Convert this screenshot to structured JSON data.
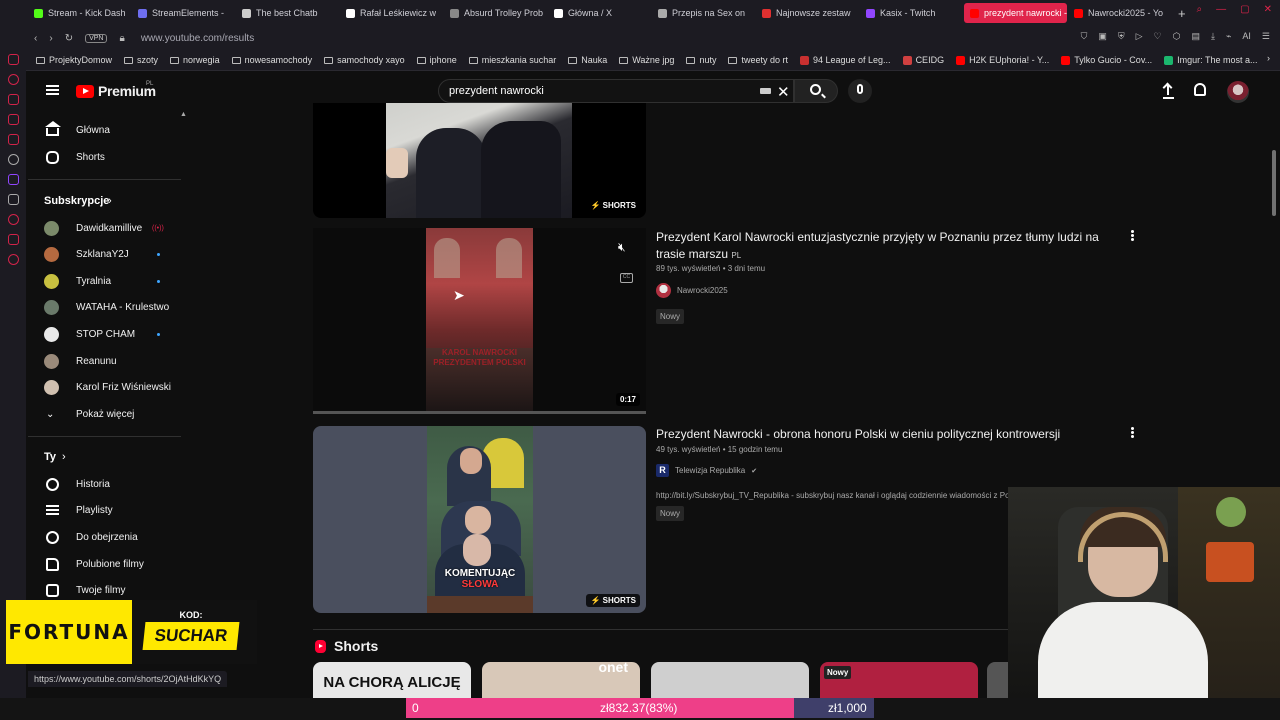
{
  "browser": {
    "tabs": [
      {
        "label": "Stream - Kick Dash",
        "color": "#53fc18"
      },
      {
        "label": "StreamElements - ",
        "color": "#6e6ef0"
      },
      {
        "label": "The best Chatb",
        "color": "#cccccc"
      },
      {
        "label": "Rafał Leśkiewicz w",
        "color": "#ffffff"
      },
      {
        "label": "Absurd Trolley Prob",
        "color": "#888888"
      },
      {
        "label": "Główna / X",
        "color": "#ffffff"
      },
      {
        "label": "Przepis na Sex on",
        "color": "#aaaaaa"
      },
      {
        "label": "Najnowsze zestaw",
        "color": "#e03030"
      },
      {
        "label": "Kasix - Twitch",
        "color": "#9146ff"
      },
      {
        "label": "prezydent nawrocki - You",
        "color": "#ff0000"
      },
      {
        "label": "Nawrocki2025 - Yo",
        "color": "#ff0000"
      }
    ],
    "active_tab": 9,
    "vpn_label": "VPN",
    "url": "www.youtube.com/results",
    "ai_label": "AI",
    "bookmarks": [
      {
        "label": "ProjektyDomow",
        "icon": "folder-icon"
      },
      {
        "label": "szoty",
        "icon": "folder-icon"
      },
      {
        "label": "norwegia",
        "icon": "folder-icon"
      },
      {
        "label": "nowesamochody",
        "icon": "folder-icon"
      },
      {
        "label": "samochody xayo",
        "icon": "folder-icon"
      },
      {
        "label": "iphone",
        "icon": "folder-icon"
      },
      {
        "label": "mieszkania suchar",
        "icon": "folder-icon"
      },
      {
        "label": "Nauka",
        "icon": "folder-icon"
      },
      {
        "label": "Ważne jpg",
        "icon": "folder-icon"
      },
      {
        "label": "nuty",
        "icon": "folder-icon"
      },
      {
        "label": "tweety do rt",
        "icon": "folder-icon"
      },
      {
        "label": "94 League of Leg...",
        "icon": "lol-icon"
      },
      {
        "label": "CEIDG",
        "icon": "ceidg-icon"
      },
      {
        "label": "H2K EUphoria! - Y...",
        "icon": "youtube-icon"
      },
      {
        "label": "Tylko Gucio - Cov...",
        "icon": "youtube-icon"
      },
      {
        "label": "Imgur: The most a...",
        "icon": "imgur-icon"
      }
    ]
  },
  "youtube": {
    "logo_text": "Premium",
    "logo_region": "PL",
    "search_query": "prezydent nawrocki",
    "sidebar": {
      "main": [
        {
          "label": "Główna",
          "icon": "home-icon"
        },
        {
          "label": "Shorts",
          "icon": "shorts-icon"
        }
      ],
      "subs_header": "Subskrypcje",
      "subs": [
        {
          "label": "Dawidkamillive",
          "avatar": "#7b8a6a",
          "live": true
        },
        {
          "label": "SzklanaY2J",
          "avatar": "#b56a40",
          "dot": true
        },
        {
          "label": "Tyralnia",
          "avatar": "#c8c040",
          "dot": true
        },
        {
          "label": "WATAHA - Krulestwo",
          "avatar": "#6a7a6a"
        },
        {
          "label": "STOP CHAM",
          "avatar": "#e8e8e8",
          "dot": true
        },
        {
          "label": "Reanunu",
          "avatar": "#9a8a7a"
        },
        {
          "label": "Karol Friz Wiśniewski",
          "avatar": "#d0c0b0"
        }
      ],
      "show_more": "Pokaż więcej",
      "you_header": "Ty",
      "you": [
        {
          "label": "Historia",
          "icon": "history-icon"
        },
        {
          "label": "Playlisty",
          "icon": "playlist-icon"
        },
        {
          "label": "Do obejrzenia",
          "icon": "clock-icon"
        },
        {
          "label": "Polubione filmy",
          "icon": "thumbs-up-icon"
        },
        {
          "label": "Twoje filmy",
          "icon": "play-box-icon"
        }
      ]
    },
    "results": [
      {
        "badge": "SHORTS"
      },
      {
        "title_line1": "Prezydent Karol Nawrocki entuzjastycznie przyjęty w Poznaniu przez tłumy ludzi na",
        "title_line2": "trasie marszu",
        "title_lang": "PL",
        "meta": "89 tys. wyświetleń • 3 dni temu",
        "channel": "Nawrocki2025",
        "tag": "Nowy",
        "duration": "0:17",
        "overlay_text_1": "KAROL NAWROCKI",
        "overlay_text_2": "PREZYDENTEM POLSKI"
      },
      {
        "title": "Prezydent Nawrocki - obrona honoru Polski w cieniu politycznej kontrowersji",
        "meta": "49 tys. wyświetleń • 15 godzin temu",
        "channel": "Telewizja Republika",
        "description": "http://bit.ly/Subskrybuj_TV_Republika - subskrybuj nasz kanał i oglądaj codziennie wiadomości z Po",
        "tag": "Nowy",
        "badge": "SHORTS",
        "caption_white": "KOMENTUJĄC ",
        "caption_red": "SŁOWA"
      }
    ],
    "shorts_section": {
      "title": "Shorts",
      "cards": [
        {
          "overlay": "NA CHORĄ ALICJĘ",
          "bg": "#e8e8e8"
        },
        {
          "overlay": "onet",
          "bg": "#d8c8b8"
        },
        {
          "overlay": "",
          "bg": "#cfcfcf"
        },
        {
          "overlay": "Nowy",
          "bg": "#b02040"
        }
      ]
    }
  },
  "overlay": {
    "fortuna_brand": "FORTUNA",
    "fortuna_code_label": "KOD:",
    "fortuna_code": "SUCHAR",
    "status_url": "https://www.youtube.com/shorts/2OjAtHdKkYQ",
    "goal_start": "0",
    "goal_current": "zł832.37(83%)",
    "goal_target": "zł1,000",
    "goal_fraction": 0.83
  }
}
